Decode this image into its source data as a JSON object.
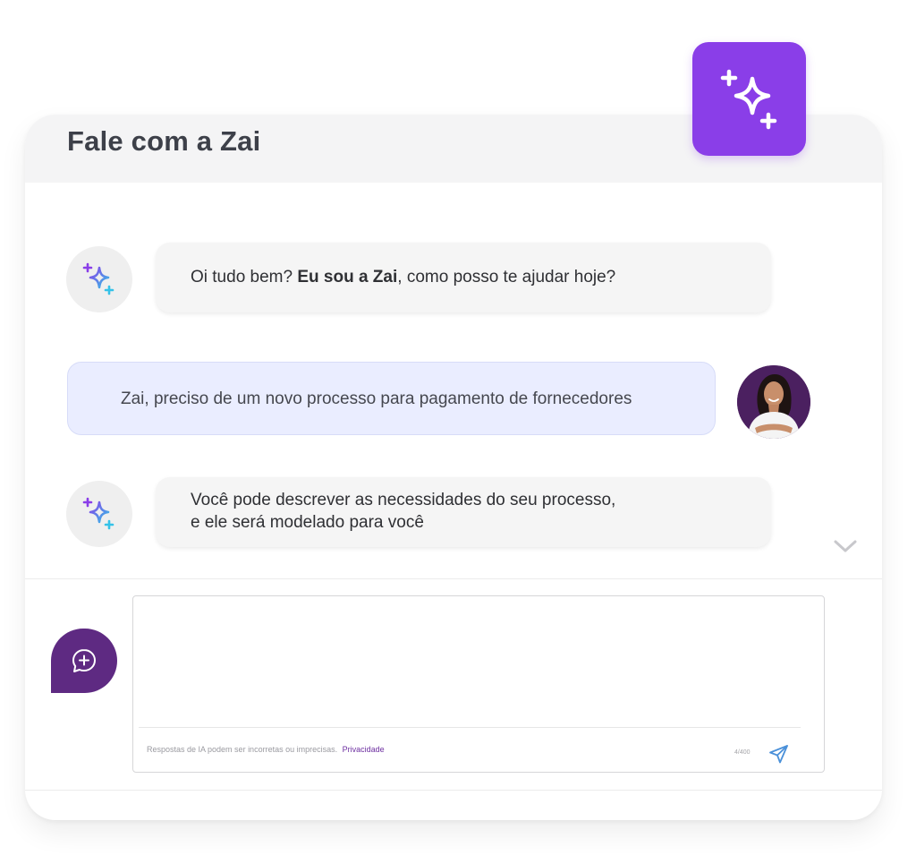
{
  "chat": {
    "title": "Fale com a Zai",
    "messages": [
      {
        "from": "ai",
        "parts": [
          "Oi tudo bem? ",
          "Eu sou a Zai",
          ", como posso te ajudar hoje?"
        ]
      },
      {
        "from": "user",
        "text": "Zai, preciso de um novo processo para pagamento de fornecedores"
      },
      {
        "from": "ai",
        "lines": [
          "Você pode descrever as necessidades do seu processo,",
          "e ele será modelado para você"
        ]
      }
    ]
  },
  "composer": {
    "input_value": "",
    "disclaimer": "Respostas de IA podem ser incorretas ou imprecisas.",
    "privacy_link": "Privacidade",
    "char_counter": "4/400"
  },
  "icons": {
    "badge": "sparkles-icon",
    "ai_avatar": "sparkles-icon",
    "scroll": "chevron-down-icon",
    "compose": "chat-plus-icon",
    "send": "send-icon"
  },
  "colors": {
    "brand_purple": "#8a3ee8",
    "dark_purple": "#5e2a82",
    "user_bubble": "#eaedff",
    "ai_bubble": "#f5f5f5",
    "send_icon": "#4a90d9"
  }
}
